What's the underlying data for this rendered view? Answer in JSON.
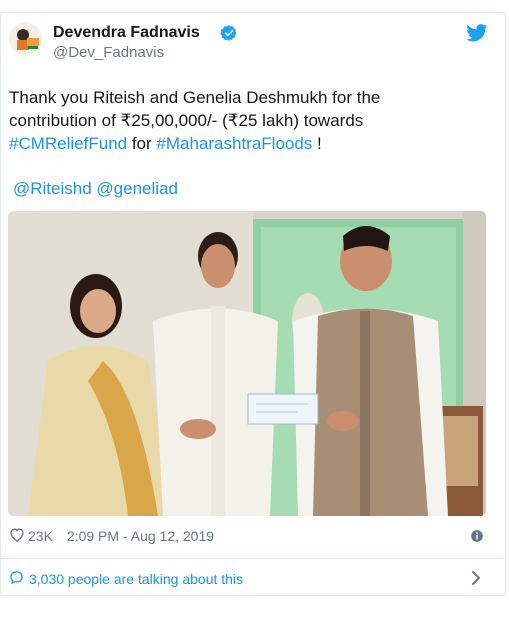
{
  "author": {
    "name": "Devendra Fadnavis",
    "handle": "@Dev_Fadnavis",
    "avatar_icon": "profile-photo-icon",
    "verified_icon": "verified-badge-icon"
  },
  "tweet": {
    "text_line1": "Thank you Riteish and Genelia Deshmukh for the",
    "text_line2": "contribution of ₹25,00,000/- (₹25 lakh) towards",
    "hashtag1": "#CMReliefFund",
    "text_between": " for ",
    "hashtag2": "#MaharashtraFloods",
    "text_end": " !",
    "mention1": "@Riteishd",
    "mention2": "@geneliad"
  },
  "meta": {
    "likes": "23K",
    "timestamp": "2:09 PM - Aug 12, 2019"
  },
  "conversation": {
    "text": "3,030 people are talking about this"
  },
  "colors": {
    "link": "#1b95e0",
    "secondary_text": "#657786",
    "border": "#e1e8ed"
  }
}
